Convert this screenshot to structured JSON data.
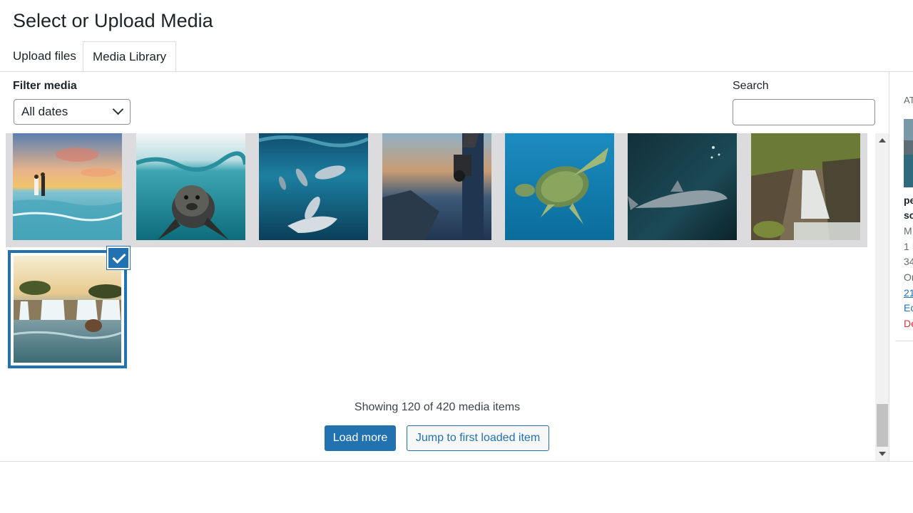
{
  "modal": {
    "title": "Select or Upload Media",
    "tabs": [
      {
        "label": "Upload files",
        "active": false
      },
      {
        "label": "Media Library",
        "active": true
      }
    ]
  },
  "toolbar": {
    "filter_label": "Filter media",
    "date_filter_value": "All dates",
    "search_label": "Search",
    "search_value": ""
  },
  "grid": {
    "items": [
      {
        "icon": "beach-couple-sunset-image"
      },
      {
        "icon": "sea-lion-underwater-image"
      },
      {
        "icon": "dolphins-underwater-image"
      },
      {
        "icon": "photographer-camera-image"
      },
      {
        "icon": "sea-turtle-image"
      },
      {
        "icon": "shark-image"
      },
      {
        "icon": "forest-waterfall-image"
      },
      {
        "icon": "waterfall-lake-image",
        "selected": true
      }
    ],
    "showing_text": "Showing 120 of 420 media items",
    "load_more_label": "Load more",
    "jump_label": "Jump to first loaded item"
  },
  "details": {
    "heading": "AT",
    "filename": "pe",
    "filename2": "sc",
    "date": "M",
    "size": "1 I",
    "dimensions": "34",
    "original": "Or",
    "link": "21",
    "edit": "Ec",
    "delete": "De"
  },
  "colors": {
    "accent": "#2271b1",
    "delete": "#d63638",
    "border": "#dcdcde"
  }
}
